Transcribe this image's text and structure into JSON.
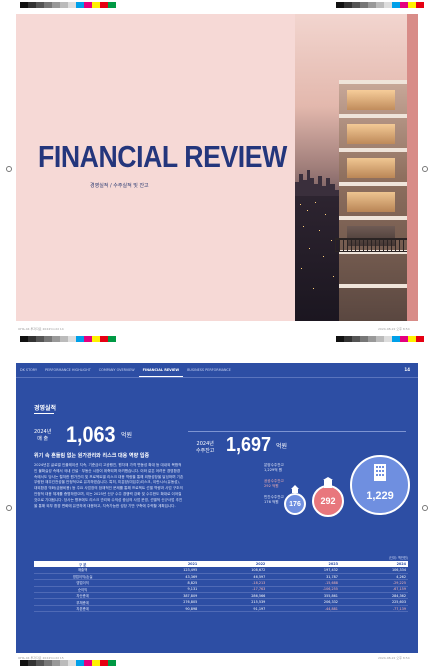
{
  "print_marks": {
    "top_file_info": "",
    "page1_footer_left": "ОНЬ-04 투자자료 2024Y.indd 14",
    "page1_footer_right": "2024-08-22  오후 8:54",
    "page2_footer_left": "ОНЬ-04 투자자료 2024Y.indd 15",
    "page2_footer_right": "2024-08-22  오후 8:54",
    "colors": [
      "#111111",
      "#333333",
      "#555555",
      "#777777",
      "#999999",
      "#bbbbbb",
      "#dddddd",
      "#00a0e9",
      "#e4007f",
      "#fff100",
      "#e60012",
      "#009944",
      "#1d2088",
      "#8fc31f",
      "#f39800"
    ]
  },
  "cover": {
    "title": "FINANCIAL REVIEW",
    "subtitle": "경영실적 / 수주실적 및 잔고",
    "background_color": "#f6d9d6",
    "title_color": "#24367c"
  },
  "page2": {
    "nav": [
      "DK STORY",
      "PERFORMANCE HIGHLIGHT",
      "COMPANY OVERVIEW",
      "FINANCIAL REVIEW",
      "BUSINESS PERFORMANCE"
    ],
    "nav_active_index": 3,
    "page_number": "14",
    "section_title": "경영실적",
    "sales": {
      "label_year": "2024년",
      "label_name": "매 출",
      "value": "1,063",
      "unit": "억원"
    },
    "backlog": {
      "label_year": "2024년",
      "label_name": "수주잔고",
      "value": "1,697",
      "unit": "억원"
    },
    "headline": "위기 속 흔들림 없는 원가관리와 리스크 대응 역량 입증",
    "body": "2024년은 글로벌 인플레이션 지속, 기준금리 고공행진, 원자재 가격 변동성 확대 등 대내외 복합적인 불확실성 속에서 국내 건설 · 부동산 시장이 위축되며 어려웠습니다. 이와 같은 어려운 경영환경 속에서도 당사는 철저한 원가관리 및 프로젝트별 리스크 대응 역량을 통해 외형성장을 달성하며 기존 우량한 재무건전성을 안정적으로 유지하였습니다. 특히, 미분양(미입주)리스크, 이란시스(유동성), 대외환경 악화(금융비용) 등 주요 사업장의 잠재적인 문제를 통해 프로젝트 선별 역량과 사업 구조의 안정적 대응 체계를 증명하였으며, 이는 2025년 신규 수주 경쟁력 강화 및 수주한도 확대로 이어질 것으로 기대됩니다. 당사는 향후에도 리스크 관리와 수익성 중심의 사업 운영, 선별적 신규사업 추진을 통해 외부 환경 변화에 유연하게 대응하고, 지속가능한 성장 기반 구축에 주력할 계획입니다.",
    "backlog_breakdown": [
      {
        "label": "분양수주잔고",
        "value": "1,229억 원",
        "bubble": "1,229",
        "color": "#6f8fe0"
      },
      {
        "label": "공공수주잔고",
        "value": "292 억원",
        "bubble": "292",
        "color": "#e8777d"
      },
      {
        "label": "민간수주잔고",
        "value": "176 억원",
        "bubble": "176",
        "color": "#6f8fe0"
      }
    ],
    "unit_note": "(단위: 백만원)",
    "table": {
      "headers": [
        "구 분",
        "2021",
        "2022",
        "2023",
        "2024"
      ],
      "rows": [
        {
          "label": "매출액",
          "values": [
            "123,495",
            "108,672",
            "197,432",
            "106,334"
          ],
          "neg": [
            false,
            false,
            false,
            false
          ]
        },
        {
          "label": "영업이익/손실",
          "values": [
            "43,369",
            "46,597",
            "31,787",
            "4,262"
          ],
          "neg": [
            false,
            false,
            false,
            false
          ]
        },
        {
          "label": "영업이익",
          "values": [
            "8,825",
            "-18,213",
            "-15,688",
            "-29,225"
          ],
          "neg": [
            false,
            true,
            true,
            true
          ]
        },
        {
          "label": "순이익",
          "values": [
            "9,131",
            "-17,763",
            "-106,255",
            "-67,159"
          ],
          "neg": [
            false,
            true,
            true,
            true
          ]
        },
        {
          "label": "자산총계",
          "values": [
            "387,809",
            "286,566",
            "355,861",
            "284,362"
          ],
          "neg": [
            false,
            false,
            false,
            false
          ]
        },
        {
          "label": "부채총계",
          "values": [
            "276,805",
            "215,539",
            "206,332",
            "225,603"
          ],
          "neg": [
            false,
            false,
            false,
            false
          ]
        },
        {
          "label": "자본총계",
          "values": [
            "90,898",
            "91,197",
            "-44,881",
            "-77,139"
          ],
          "neg": [
            false,
            false,
            true,
            true
          ]
        }
      ]
    }
  }
}
